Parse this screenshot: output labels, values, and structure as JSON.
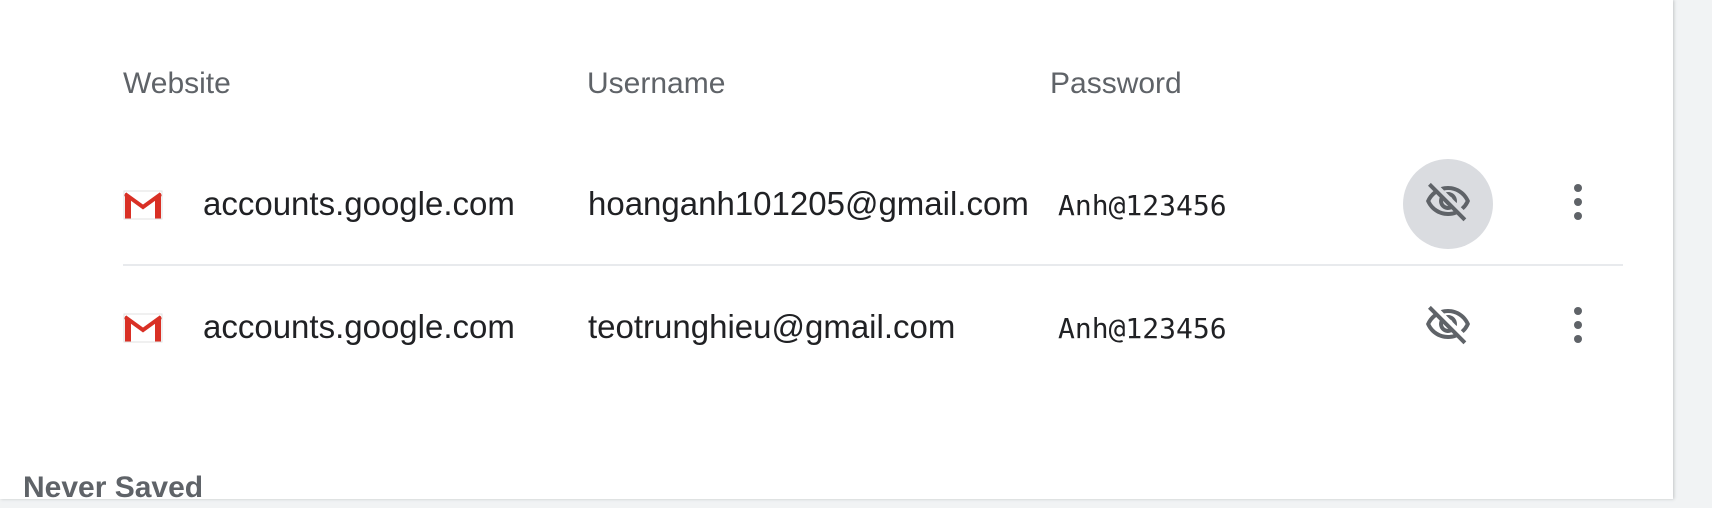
{
  "table": {
    "headers": {
      "website": "Website",
      "username": "Username",
      "password": "Password"
    },
    "rows": [
      {
        "site_icon": "gmail-icon",
        "website": "accounts.google.com",
        "username": "hoanganh101205@gmail.com",
        "password": "Anh@123456",
        "reveal_icon": "eye-off-icon",
        "more_icon": "more-vertical-icon"
      },
      {
        "site_icon": "gmail-icon",
        "website": "accounts.google.com",
        "username": "teotrunghieu@gmail.com",
        "password": "Anh@123456",
        "reveal_icon": "eye-off-icon",
        "more_icon": "more-vertical-icon"
      }
    ]
  },
  "never_saved": {
    "title": "Never Saved"
  },
  "colors": {
    "text_primary": "#202124",
    "text_secondary": "#5f6368",
    "icon": "#5f6368",
    "active_button_bg": "#dadce0",
    "divider": "#e8eaed",
    "gmail_red": "#d93025"
  }
}
